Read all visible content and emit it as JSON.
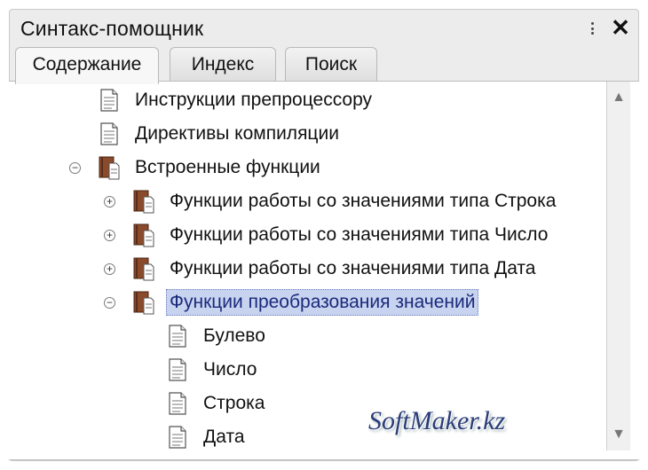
{
  "window": {
    "title": "Синтакс-помощник",
    "close_label": "✕"
  },
  "tabs": [
    {
      "label": "Содержание",
      "active": true
    },
    {
      "label": "Индекс",
      "active": false
    },
    {
      "label": "Поиск",
      "active": false
    }
  ],
  "tree": [
    {
      "label": "Инструкции препроцессору",
      "icon": "document-icon",
      "expander": ""
    },
    {
      "label": "Директивы компиляции",
      "icon": "document-icon",
      "expander": ""
    },
    {
      "label": "Встроенные функции",
      "icon": "book-icon",
      "expander": "⊖"
    },
    {
      "label": "Функции работы со значениями типа Строка",
      "icon": "book-icon",
      "expander": "⊕"
    },
    {
      "label": "Функции работы со значениями типа Число",
      "icon": "book-icon",
      "expander": "⊕"
    },
    {
      "label": "Функции работы со значениями типа Дата",
      "icon": "book-icon",
      "expander": "⊕"
    },
    {
      "label": "Функции преобразования значений",
      "icon": "book-icon",
      "expander": "⊖",
      "selected": true
    },
    {
      "label": "Булево",
      "icon": "document-icon",
      "expander": ""
    },
    {
      "label": "Число",
      "icon": "document-icon",
      "expander": ""
    },
    {
      "label": "Строка",
      "icon": "document-icon",
      "expander": ""
    },
    {
      "label": "Дата",
      "icon": "document-icon",
      "expander": ""
    }
  ],
  "scrollbar": {
    "up_label": "▲",
    "down_label": "▼"
  },
  "watermark": "SoftMaker.kz",
  "colors": {
    "selection": "#c8d3f0",
    "book": "#8a4a2c",
    "watermark": "#2a3d78"
  }
}
